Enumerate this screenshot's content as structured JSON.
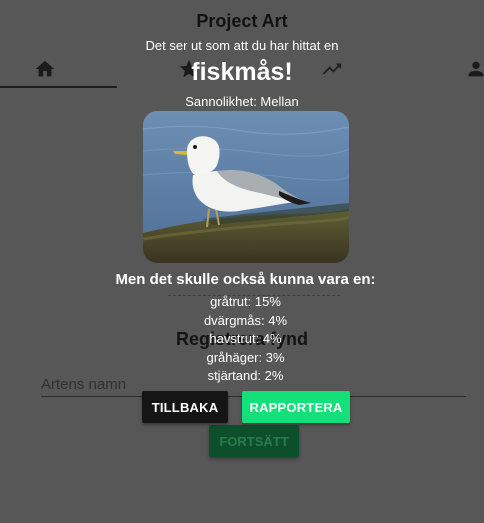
{
  "app": {
    "title": "Project Art",
    "nav_icons": [
      "home-icon",
      "star-icon",
      "trending-up-icon",
      "person-icon"
    ]
  },
  "background": {
    "heading": "Registrera fynd",
    "species_input_placeholder": "Artens namn",
    "continue_label": "FORTSÄTT"
  },
  "modal": {
    "intro": "Det ser ut som att du har hittat en",
    "species": "fiskmås!",
    "probability": "Sannolikhet: Mellan",
    "alternatives_heading": "Men det skulle också kunna vara en:",
    "alternatives": [
      "gråtrut: 15%",
      "dvärgmås: 4%",
      "havstrut: 4%",
      "gråhäger: 3%",
      "stjärtand: 2%"
    ],
    "back_label": "TILLBAKA",
    "report_label": "RAPPORTERA"
  },
  "colors": {
    "overlay_background": "#575757",
    "report_button": "#14e07a",
    "back_button": "#151515",
    "continue_button": "#0d4f2b"
  }
}
